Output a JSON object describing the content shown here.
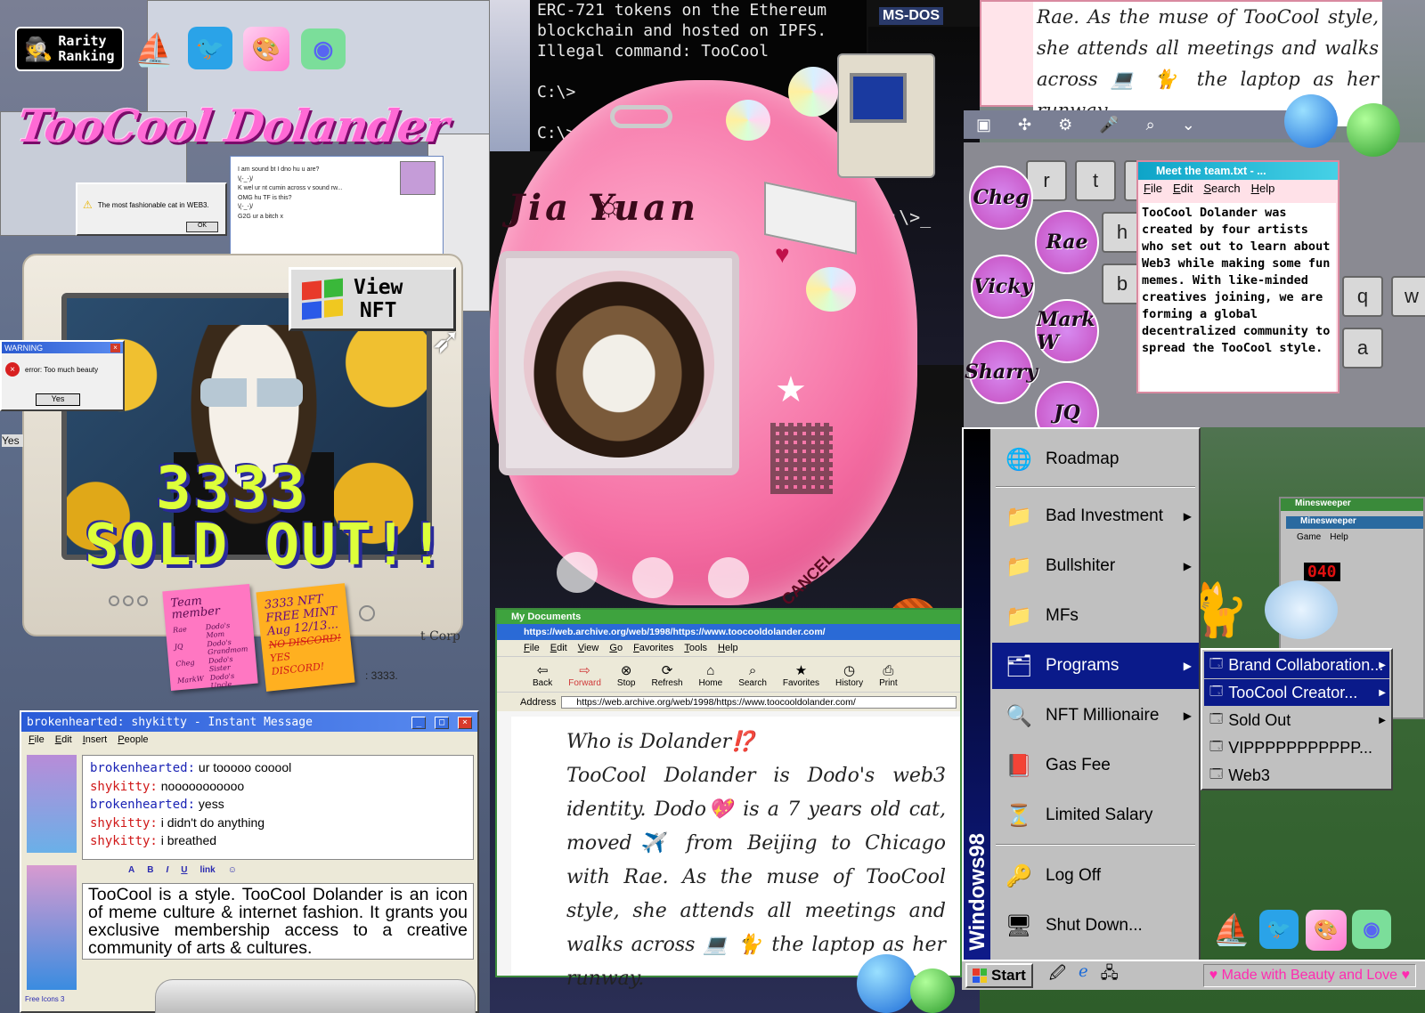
{
  "left": {
    "rarity": {
      "label_line1": "Rarity",
      "label_line2": "Ranking"
    },
    "brand_title": "TooCool Dolander",
    "dialog_fashion": "The most fashionable cat in WEB3.",
    "dialog_ok": "OK",
    "warning": {
      "title": "WARNING",
      "message": "error: Too much beauty",
      "button": "Yes"
    },
    "side_yes": "Yes",
    "chat_bg": {
      "lines": [
        "I am sound bt I dno hu u are?",
        "\\(-_-)/",
        "K wel ur nt cumin across v sound rw...",
        "OMG hu TF is this?",
        "\\(-_-)/",
        "G2G ur a bitch x"
      ]
    },
    "view_nft": {
      "line1": "View",
      "line2": "NFT"
    },
    "count": "3333",
    "sold_out": "SOLD OUT!!",
    "sticky_pink": {
      "title": "Team member",
      "names": [
        "Rae",
        "Dodo's Mom",
        "JQ",
        "Dodo's Grandmom",
        "Cheg",
        "Dodo's Sister",
        "MarkW",
        "Dodo's Uncle"
      ]
    },
    "sticky_orange": {
      "line1": "3333 NFT",
      "line2": "FREE MINT",
      "line3": "Aug 12/13...",
      "strike": "NO DISCORD!",
      "yes": "YES DISCORD!"
    },
    "bg_3333": ": 3333.",
    "bg_corp": "t Corp",
    "im": {
      "title": "brokenhearted: shykitty - Instant Message",
      "menu": [
        "File",
        "Edit",
        "Insert",
        "People"
      ],
      "chat": [
        {
          "name": "brokenhearted:",
          "text": "ur tooooo cooool",
          "who": "a"
        },
        {
          "name": "shykitty:",
          "text": "nooooooooooo",
          "who": "b"
        },
        {
          "name": "brokenhearted:",
          "text": "yess",
          "who": "a"
        },
        {
          "name": "shykitty:",
          "text": "i didn't do anything",
          "who": "b"
        },
        {
          "name": "shykitty:",
          "text": "i breathed",
          "who": "b"
        }
      ],
      "compose": "TooCool is a style. TooCool Dolander is an icon of meme culture & internet fashion.  It grants you exclusive membership access to a creative community of arts & cultures.",
      "free_icons": "Free Icons 3"
    }
  },
  "middle": {
    "terminal": [
      "ERC-721 tokens on the Ethereum",
      "blockchain and hosted on IPFS.",
      "Illegal command: TooCool",
      "",
      "C:\\>",
      "",
      "C:\\>"
    ],
    "msdos": "MS-DOS",
    "jia_yuan": "Jia Yuan",
    "cancel": "CANCEL",
    "terminal_right": "C:\\>_",
    "mydocs": {
      "title": "My Documents",
      "url_bar": "https://web.archive.org/web/1998/https://www.toocooldolander.com/",
      "menu": [
        "File",
        "Edit",
        "View",
        "Go",
        "Favorites",
        "Tools",
        "Help"
      ],
      "toolbar": [
        "Back",
        "Forward",
        "Stop",
        "Refresh",
        "Home",
        "Search",
        "Favorites",
        "History",
        "Print"
      ],
      "address_label": "Address",
      "address": "https://web.archive.org/web/1998/https://www.toocooldolander.com/"
    },
    "story": {
      "heading": "Who is Dolander⁉️",
      "body": "TooCool Dolander is Dodo's web3 identity. Dodo💖 is a 7 years old cat, moved✈️ from Beijing to Chicago with Rae. As the muse of TooCool style, she attends all meetings and walks across 💻 🐈 the laptop as her runway."
    }
  },
  "right": {
    "top_story": "Rae. As the muse of TooCool style, she attends all meetings and walks across 💻 🐈 the laptop as her runway.",
    "keys": [
      "r",
      "t",
      "y",
      "h",
      "b",
      "q",
      "w",
      "a"
    ],
    "members": [
      "Cheg",
      "Rae",
      "Vicky",
      "Mark W",
      "Sharry",
      "JQ"
    ],
    "notepad": {
      "title": "Meet the team.txt - ...",
      "menu": [
        "File",
        "Edit",
        "Search",
        "Help"
      ],
      "body": "TooCool Dolander was created by four artists who set out to learn about Web3 while making some fun memes. With like-minded creatives joining, we are forming a global decentralized community to spread the TooCool style."
    },
    "start_menu": {
      "band": "Windows98",
      "items": [
        {
          "label": "Roadmap",
          "icon": "globe-icon",
          "arrow": false
        },
        {
          "label": "Bad Investment",
          "icon": "folder-icon",
          "arrow": true
        },
        {
          "label": "Bullshiter",
          "icon": "folder-icon",
          "arrow": true
        },
        {
          "label": "MFs",
          "icon": "folder-icon",
          "arrow": false
        },
        {
          "label": "Programs",
          "icon": "programs-icon",
          "arrow": true
        },
        {
          "label": "NFT Millionaire",
          "icon": "search-icon",
          "arrow": true
        },
        {
          "label": "Gas Fee",
          "icon": "book-icon",
          "arrow": false
        },
        {
          "label": "Limited Salary",
          "icon": "hourglass-icon",
          "arrow": false
        },
        {
          "label": "Log Off",
          "icon": "key-icon",
          "arrow": false
        },
        {
          "label": "Shut Down...",
          "icon": "shutdown-icon",
          "arrow": false
        }
      ]
    },
    "submenu": [
      {
        "label": "Brand Collaboration...",
        "arrow": true
      },
      {
        "label": "TooCool Creator...",
        "arrow": true
      },
      {
        "label": "Sold Out",
        "arrow": true
      },
      {
        "label": "VIPPPPPPPPPPP...",
        "arrow": false
      },
      {
        "label": "Web3",
        "arrow": false
      }
    ],
    "minesweeper": {
      "title": "Minesweeper",
      "menu": [
        "Game",
        "Help"
      ],
      "counter": "040"
    },
    "taskbar": {
      "start": "Start",
      "tagline": "♥ Made with Beauty and Love ♥"
    }
  },
  "colors": {
    "accent_pink": "#ff6ad5",
    "lime": "#ddff3a",
    "win_blue": "#0a246a",
    "tagline": "#ff2bb0"
  }
}
